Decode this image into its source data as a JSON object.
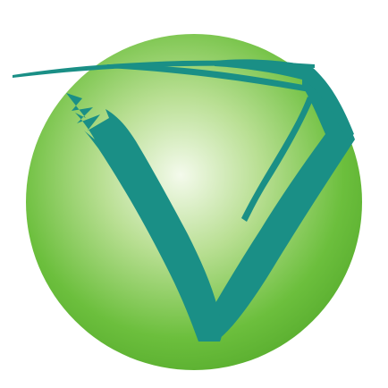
{
  "logo": {
    "name": "green-sphere-v-logo",
    "colors": {
      "sphere_center": "#f4faec",
      "sphere_mid": "#b9df93",
      "sphere_edge": "#6cbf3d",
      "sphere_rim": "#58ad2e",
      "mark": "#1a8f86",
      "background": "#ffffff"
    }
  }
}
